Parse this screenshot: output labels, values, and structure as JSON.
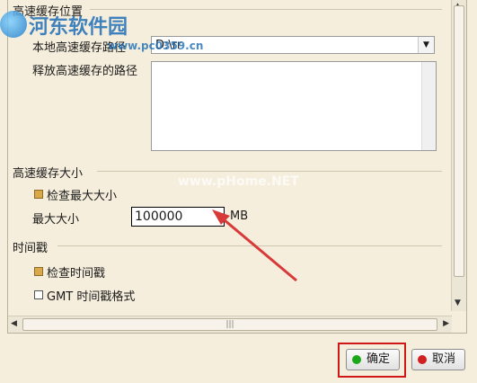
{
  "groups": {
    "cache_location": "高速缓存位置",
    "cache_size": "高速缓存大小",
    "timestamp": "时间戳"
  },
  "local_cache_path": {
    "label": "本地高速缓存路径",
    "value": "D:\\rr"
  },
  "release_cache_path": {
    "label": "释放高速缓存的路径"
  },
  "check_max_size": {
    "label": "检查最大大小",
    "checked": true
  },
  "max_size": {
    "label": "最大大小",
    "value": "100000",
    "unit": "MB"
  },
  "check_timestamp": {
    "label": "检查时间戳",
    "checked": true
  },
  "gmt_timestamp": {
    "label": "GMT 时间戳格式",
    "checked": false
  },
  "buttons": {
    "ok": "确定",
    "cancel": "取消"
  },
  "watermarks": {
    "site1": "河东软件园",
    "site1_url": "www.pc0359.cn",
    "site2": "www.pHome.NET"
  },
  "colors": {
    "ok_dot": "#1aa81a",
    "cancel_dot": "#d02020",
    "highlight": "#d01818",
    "arrow": "#d83a3a"
  }
}
